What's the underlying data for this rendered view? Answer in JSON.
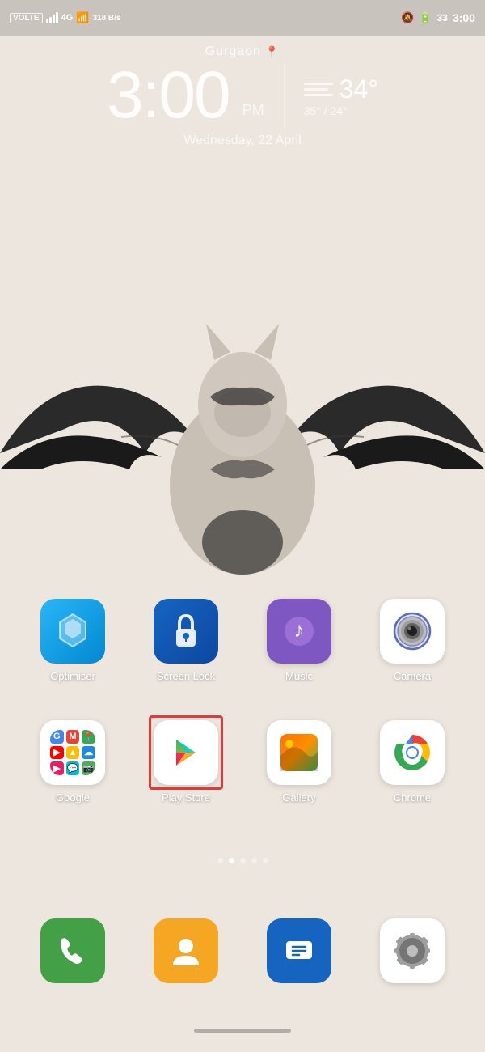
{
  "statusBar": {
    "carrier": "VOLTE",
    "signal": "4G",
    "network_speed": "318 B/s",
    "time": "3:00",
    "battery": "33"
  },
  "weather": {
    "location": "Gurgaon",
    "time": "3:00",
    "period": "PM",
    "temp_current": "34°",
    "temp_range": "35° / 24°",
    "date": "Wednesday, 22 April"
  },
  "apps_row1": [
    {
      "id": "optimiser",
      "label": "Optimiser"
    },
    {
      "id": "screenlock",
      "label": "Screen Lock"
    },
    {
      "id": "music",
      "label": "Music"
    },
    {
      "id": "camera",
      "label": "Camera"
    }
  ],
  "apps_row2": [
    {
      "id": "google",
      "label": "Google"
    },
    {
      "id": "playstore",
      "label": "Play Store"
    },
    {
      "id": "gallery",
      "label": "Gallery"
    },
    {
      "id": "chrome",
      "label": "Chrome"
    }
  ],
  "dock": [
    {
      "id": "phone",
      "label": "Phone"
    },
    {
      "id": "contacts",
      "label": "Contacts"
    },
    {
      "id": "messages",
      "label": "Messages"
    },
    {
      "id": "settings",
      "label": "Settings"
    }
  ],
  "pageDots": 5,
  "activeDot": 1
}
